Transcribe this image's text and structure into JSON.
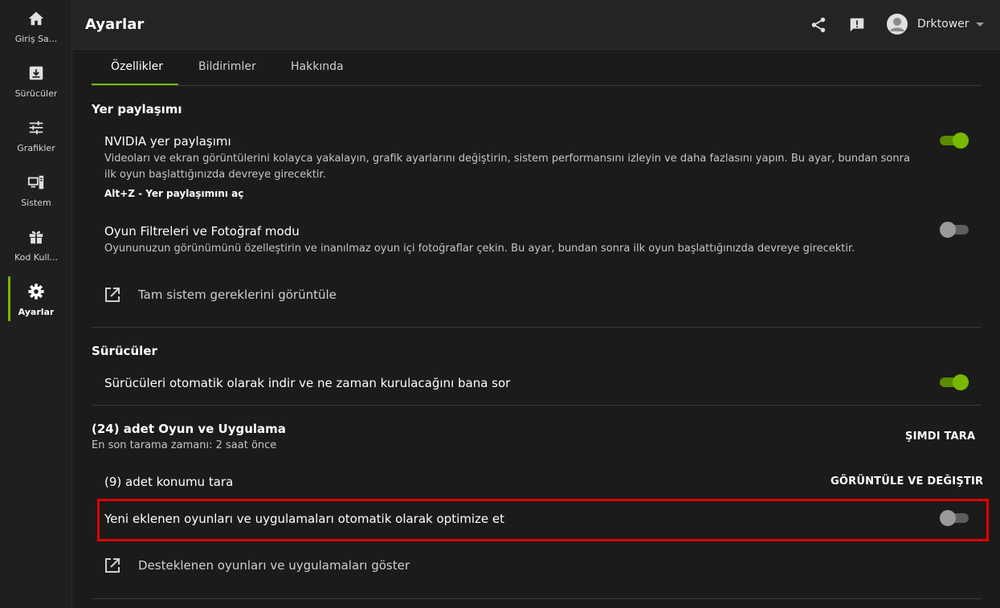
{
  "sidebar": {
    "items": [
      {
        "label": "Giriş Sa...",
        "icon": "home-icon"
      },
      {
        "label": "Sürücüler",
        "icon": "download-box-icon"
      },
      {
        "label": "Grafikler",
        "icon": "sliders-icon"
      },
      {
        "label": "Sistem",
        "icon": "monitor-tower-icon"
      },
      {
        "label": "Kod Kull...",
        "icon": "gift-icon"
      },
      {
        "label": "Ayarlar",
        "icon": "gear-icon"
      }
    ],
    "active_index": 5
  },
  "header": {
    "title": "Ayarlar",
    "username": "Drktower"
  },
  "tabs": [
    {
      "label": "Özellikler",
      "active": true
    },
    {
      "label": "Bildirimler",
      "active": false
    },
    {
      "label": "Hakkında",
      "active": false
    }
  ],
  "sections": {
    "share": {
      "title": "Yer paylaşımı",
      "overlay": {
        "title": "NVIDIA yer paylaşımı",
        "desc_line1": "Videoları ve ekran görüntülerini kolayca yakalayın, grafik ayarlarını değiştirin, sistem performansını izleyin ve daha fazlasını yapın. Bu ayar, bundan sonra",
        "desc_line2": "ilk oyun başlattığınızda devreye girecektir.",
        "shortcut": "Alt+Z - Yer paylaşımını aç",
        "enabled": true
      },
      "filters": {
        "title": "Oyun Filtreleri ve Fotoğraf modu",
        "desc": "Oyununuzun görünümünü özelleştirin ve inanılmaz oyun içi fotoğraflar çekin. Bu ayar, bundan sonra ilk oyun başlattığınızda devreye girecektir.",
        "enabled": false
      },
      "link": "Tam sistem gereklerini görüntüle"
    },
    "drivers": {
      "title": "Sürücüler",
      "auto_download": {
        "title": "Sürücüleri otomatik olarak indir ve ne zaman kurulacağını bana sor",
        "enabled": true
      }
    },
    "games": {
      "title": "(24) adet Oyun ve Uygulama",
      "last_scan": "En son tarama zamanı: 2 saat önce",
      "scan_now": "ŞIMDI TARA",
      "locations": "(9) adet konumu tara",
      "view_change": "GÖRÜNTÜLE VE DEĞIŞTIR",
      "auto_optimize": {
        "title": "Yeni eklenen oyunları ve uygulamaları otomatik olarak optimize et",
        "enabled": false
      },
      "link": "Desteklenen oyunları ve uygulamaları göster"
    }
  },
  "colors": {
    "accent": "#76b900",
    "highlight": "#e10000"
  }
}
